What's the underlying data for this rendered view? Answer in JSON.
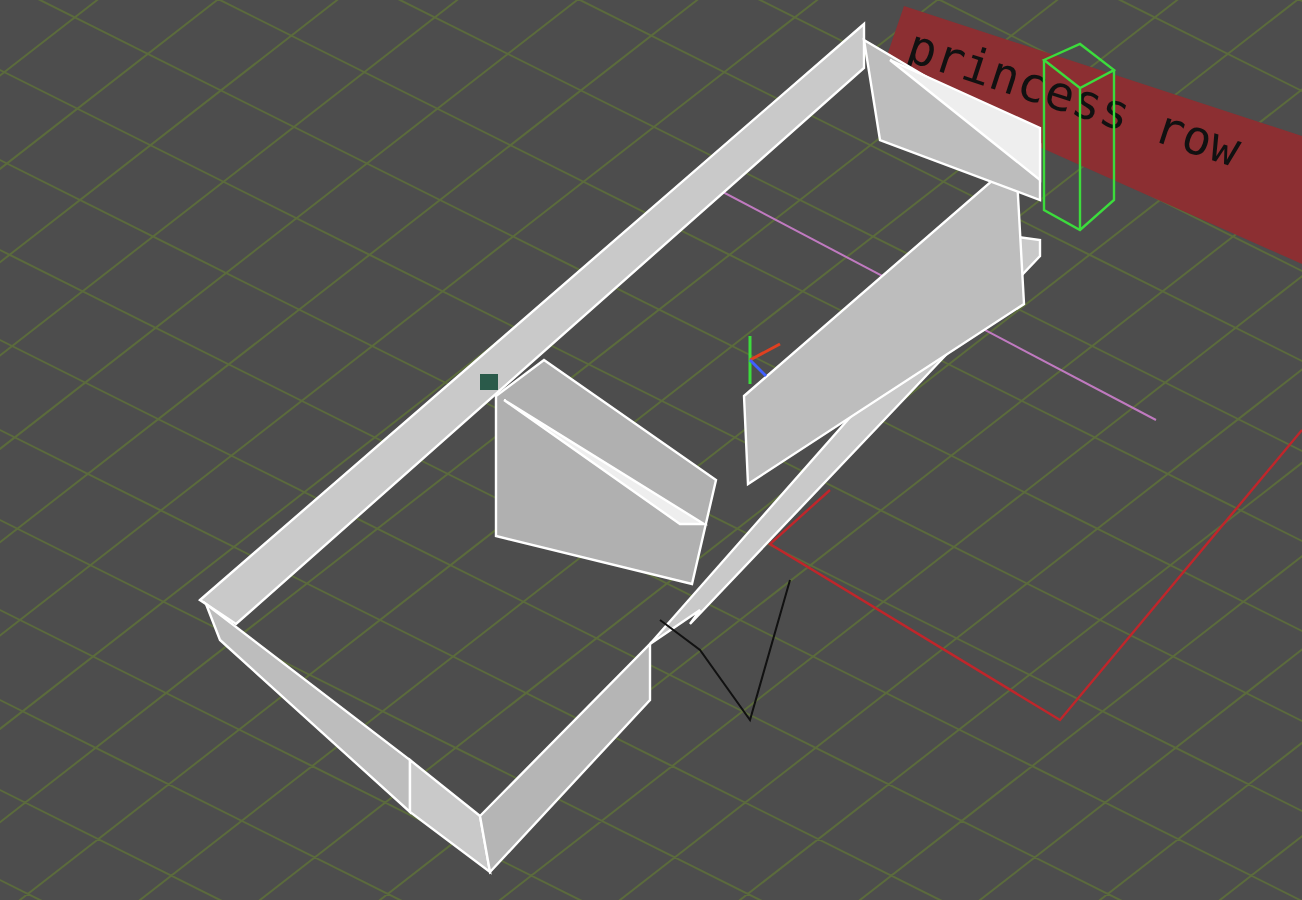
{
  "viewport": {
    "floor_label": "princess row"
  }
}
